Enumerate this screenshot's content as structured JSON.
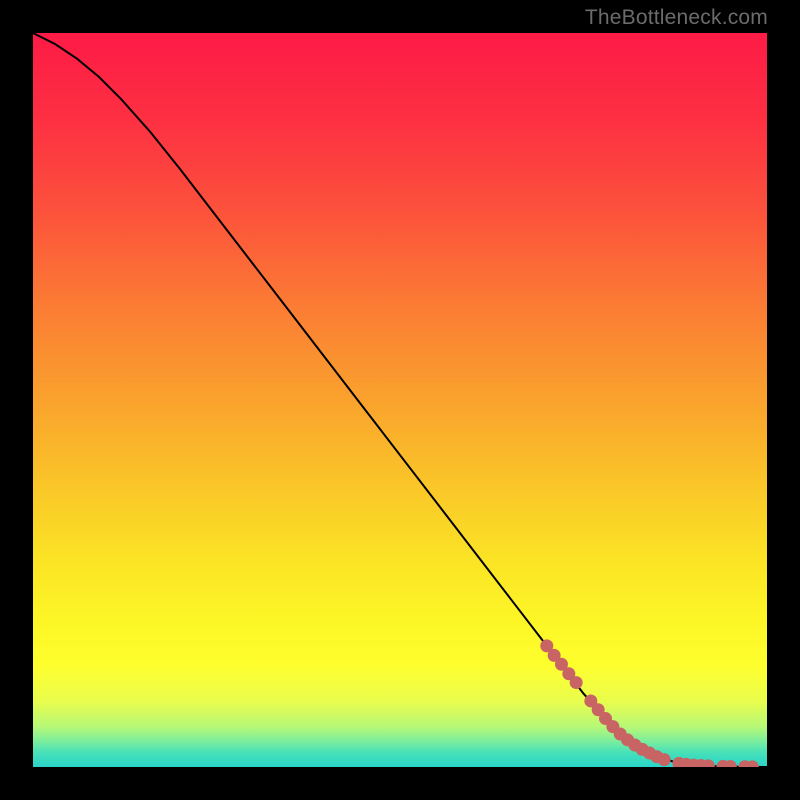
{
  "watermark": "TheBottleneck.com",
  "colors": {
    "background": "#000000",
    "curve": "#000000",
    "marker_fill": "#c86464",
    "marker_stroke": "#c86464"
  },
  "chart_data": {
    "type": "line",
    "title": "",
    "xlabel": "",
    "ylabel": "",
    "xlim": [
      0,
      100
    ],
    "ylim": [
      0,
      100
    ],
    "gradient_stops": [
      {
        "offset": 0.0,
        "color": "#fd1b46"
      },
      {
        "offset": 0.12,
        "color": "#fd3042"
      },
      {
        "offset": 0.25,
        "color": "#fc543b"
      },
      {
        "offset": 0.37,
        "color": "#fb7b34"
      },
      {
        "offset": 0.5,
        "color": "#faa22d"
      },
      {
        "offset": 0.62,
        "color": "#fac728"
      },
      {
        "offset": 0.72,
        "color": "#fbe425"
      },
      {
        "offset": 0.8,
        "color": "#fdf626"
      },
      {
        "offset": 0.86,
        "color": "#fefe2d"
      },
      {
        "offset": 0.91,
        "color": "#eafd4c"
      },
      {
        "offset": 0.945,
        "color": "#b7f877"
      },
      {
        "offset": 0.965,
        "color": "#7bee9d"
      },
      {
        "offset": 0.98,
        "color": "#48e1b8"
      },
      {
        "offset": 1.0,
        "color": "#28d4c9"
      }
    ],
    "series": [
      {
        "name": "curve",
        "x": [
          0,
          3,
          6,
          9,
          12,
          16,
          20,
          25,
          30,
          35,
          40,
          45,
          50,
          55,
          60,
          65,
          70,
          75,
          80,
          83,
          85,
          87,
          89,
          91,
          93,
          95,
          97,
          100
        ],
        "y": [
          100,
          98.5,
          96.5,
          94,
          91,
          86.5,
          81.5,
          75,
          68.5,
          62,
          55.5,
          49,
          42.5,
          36,
          29.5,
          23,
          16.5,
          10,
          4.5,
          2.5,
          1.5,
          0.8,
          0.4,
          0.2,
          0.1,
          0.05,
          0.02,
          0
        ]
      }
    ],
    "markers": {
      "name": "points",
      "x": [
        70,
        71,
        72,
        73,
        74,
        76,
        77,
        78,
        79,
        80,
        81,
        82,
        83,
        84,
        85,
        86,
        88,
        89,
        90,
        91,
        92,
        94,
        95,
        97,
        98
      ],
      "y": [
        16.5,
        15.2,
        14,
        12.7,
        11.5,
        9,
        7.8,
        6.6,
        5.5,
        4.5,
        3.7,
        3.0,
        2.4,
        1.9,
        1.4,
        1.0,
        0.5,
        0.35,
        0.25,
        0.2,
        0.15,
        0.08,
        0.06,
        0.03,
        0.02
      ]
    }
  }
}
